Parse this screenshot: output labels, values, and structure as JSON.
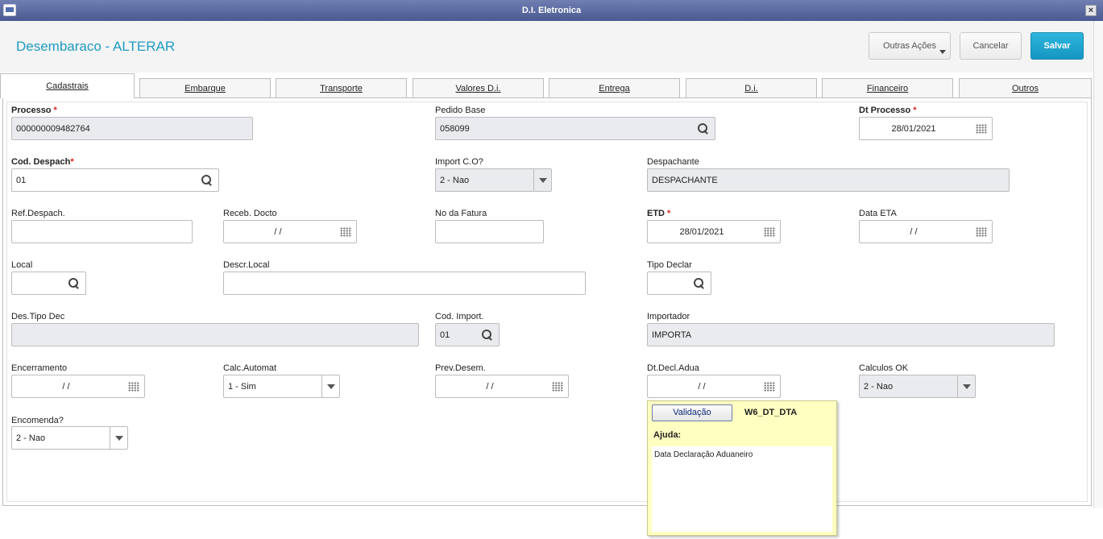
{
  "window": {
    "title": "D.I. Eletronica",
    "close_label": "×"
  },
  "header": {
    "title": "Desembaraco - ALTERAR",
    "buttons": {
      "outras": "Outras Ações",
      "cancelar": "Cancelar",
      "salvar": "Salvar"
    }
  },
  "tabs": [
    "Cadastrais",
    "Embarque",
    "Transporte",
    "Valores D.i.",
    "Entrega",
    "D.i.",
    "Financeiro",
    "Outros"
  ],
  "fields": {
    "processo": {
      "label": "Processo",
      "value": "000000009482764"
    },
    "pedido_base": {
      "label": "Pedido Base",
      "value": "058099"
    },
    "dt_processo": {
      "label": "Dt Processo",
      "value": "28/01/2021"
    },
    "cod_despach": {
      "label": "Cod. Despach",
      "value": "01"
    },
    "import_co": {
      "label": "Import C.O?",
      "value": "2 - Nao"
    },
    "despachante": {
      "label": "Despachante",
      "value": "DESPACHANTE"
    },
    "ref_despach": {
      "label": "Ref.Despach.",
      "value": ""
    },
    "receb_docto": {
      "label": "Receb. Docto",
      "value": "/ /"
    },
    "no_fatura": {
      "label": "No da Fatura",
      "value": ""
    },
    "etd": {
      "label": "ETD",
      "value": "28/01/2021"
    },
    "data_eta": {
      "label": "Data ETA",
      "value": "/ /"
    },
    "local": {
      "label": "Local",
      "value": ""
    },
    "descr_local": {
      "label": "Descr.Local",
      "value": ""
    },
    "tipo_declar": {
      "label": "Tipo Declar",
      "value": ""
    },
    "des_tipo_dec": {
      "label": "Des.Tipo Dec",
      "value": ""
    },
    "cod_import": {
      "label": "Cod. Import.",
      "value": "01"
    },
    "importador": {
      "label": "Importador",
      "value": "IMPORTA"
    },
    "encerramento": {
      "label": "Encerramento",
      "value": "/ /"
    },
    "calc_automat": {
      "label": "Calc.Automat",
      "value": "1 - Sim"
    },
    "prev_desem": {
      "label": "Prev.Desem.",
      "value": "/ /"
    },
    "dt_decl_adua": {
      "label": "Dt.Decl.Adua",
      "value": "/ /"
    },
    "calculos_ok": {
      "label": "Calculos OK",
      "value": "2 - Nao"
    },
    "encomenda": {
      "label": "Encomenda?",
      "value": "2 - Nao"
    }
  },
  "required_mark": "*",
  "help": {
    "button": "Validação",
    "code": "W6_DT_DTA",
    "ajuda_label": "Ajuda:",
    "text": "Data Declaração Aduaneiro"
  }
}
